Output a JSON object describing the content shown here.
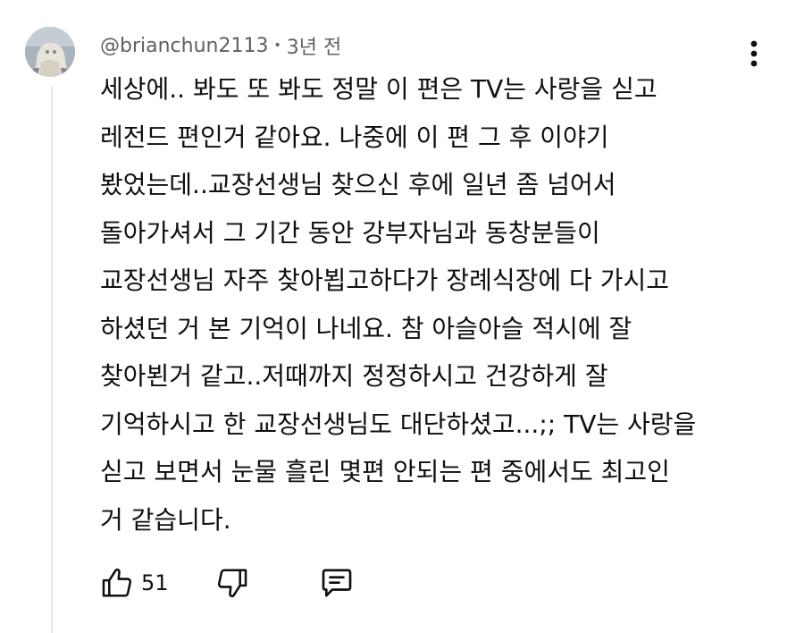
{
  "comment": {
    "author": "@brianchun2113",
    "separator": "•",
    "time": "3년 전",
    "text": "세상에.. 봐도 또 봐도 정말 이 편은 TV는 사랑을 싣고\n레전드 편인거 같아요. 나중에 이 편 그 후 이야기\n봤었는데..교장선생님 찾으신 후에 일년 좀 넘어서\n돌아가셔서 그 기간 동안 강부자님과 동창분들이\n교장선생님 자주 찾아뵙고하다가 장례식장에 다 가시고\n하셨던 거 본 기억이 나네요. 참 아슬아슬 적시에 잘\n찾아뵌거 같고..저때까지 정정하시고 건강하게 잘\n기억하시고 한 교장선생님도 대단하셨고...;; TV는 사랑을\n싣고 보면서 눈물 흘린 몇편 안되는 편 중에서도 최고인\n거 같습니다.",
    "like_count": "51"
  },
  "icons": {
    "avatar": "avatar-image",
    "more": "more-vert-icon",
    "like": "thumbs-up-icon",
    "dislike": "thumbs-down-icon",
    "reply": "reply-comment-icon"
  },
  "colors": {
    "text": "#0f0f0f",
    "secondary": "#606060",
    "thread_line": "#e6e6e6"
  }
}
